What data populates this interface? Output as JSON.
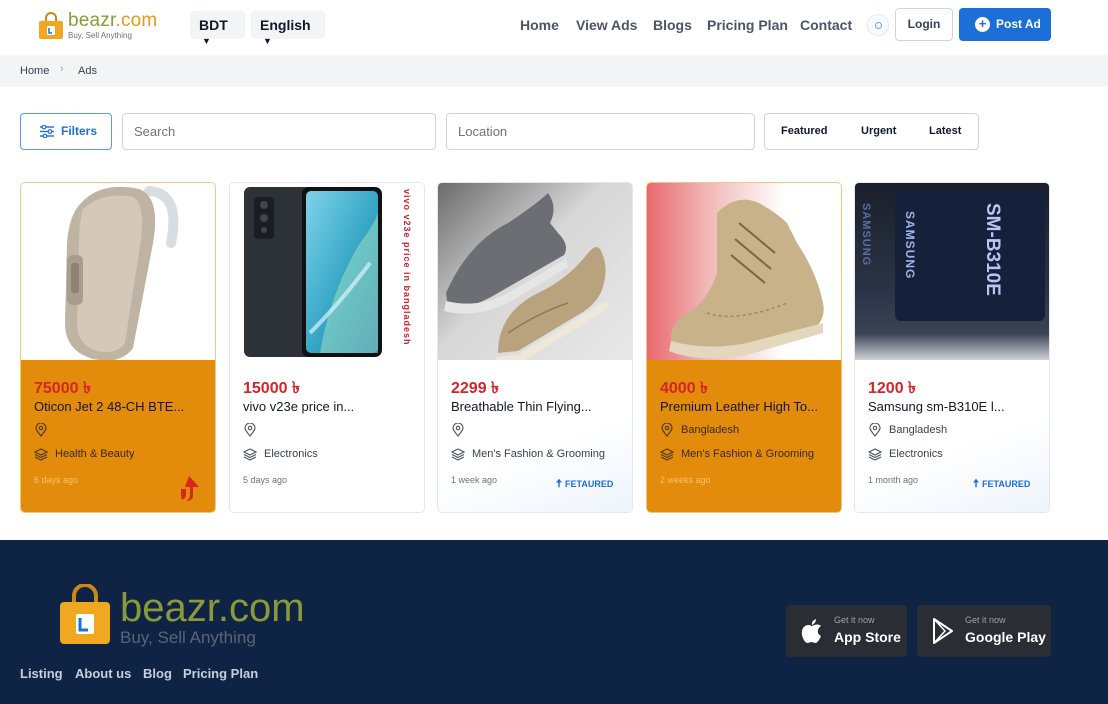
{
  "header": {
    "brand_main": "beazr",
    "brand_suffix": ".com",
    "tagline": "Buy, Sell Anything",
    "currency": "BDT",
    "language": "English",
    "nav": [
      "Home",
      "View Ads",
      "Blogs",
      "Pricing Plan",
      "Contact"
    ],
    "login_label": "Login",
    "post_ad_label": "Post Ad"
  },
  "breadcrumb": [
    "Home",
    "Ads"
  ],
  "filters": {
    "filters_label": "Filters",
    "search_placeholder": "Search",
    "location_placeholder": "Location",
    "sort_options": [
      "Featured",
      "Urgent",
      "Latest"
    ]
  },
  "listings": [
    {
      "price": "75000 ৳",
      "title": "Oticon Jet 2 48-CH BTE...",
      "location": "",
      "category": "Health & Beauty",
      "time": "6 days ago",
      "badge": "urgent",
      "highlighted": true
    },
    {
      "price": "15000 ৳",
      "title": "vivo v23e price in...",
      "location": "",
      "category": "Electronics",
      "time": "5 days ago",
      "badge": "",
      "highlighted": false,
      "image_text": "vivo v23e price in bangladesh"
    },
    {
      "price": "2299 ৳",
      "title": "Breathable Thin Flying...",
      "location": "",
      "category": "Men's Fashion & Grooming",
      "time": "1 week ago",
      "badge": "FETAURED",
      "highlighted": false
    },
    {
      "price": "4000 ৳",
      "title": "Premium Leather High To...",
      "location": "Bangladesh",
      "category": "Men's Fashion & Grooming",
      "time": "2 weeks ago",
      "badge": "",
      "highlighted": true
    },
    {
      "price": "1200 ৳",
      "title": "Samsung sm-B310E l...",
      "location": "Bangladesh",
      "category": "Electronics",
      "time": "1 month ago",
      "badge": "FETAURED",
      "highlighted": false,
      "image_text": [
        "SAMSUNG",
        "SAMSUNG",
        "SM-B310E"
      ]
    }
  ],
  "footer": {
    "brand": "beazr.com",
    "tagline": "Buy, Sell Anything",
    "links": [
      "Listing",
      "About us",
      "Blog",
      "Pricing Plan"
    ],
    "stores": [
      {
        "small": "Get it now",
        "big": "App Store"
      },
      {
        "small": "Get it now",
        "big": "Google Play"
      }
    ]
  },
  "colors": {
    "accent": "#1c6fd6",
    "highlight": "#e38b0b",
    "price": "#d4262a",
    "footer": "#0f2444"
  }
}
